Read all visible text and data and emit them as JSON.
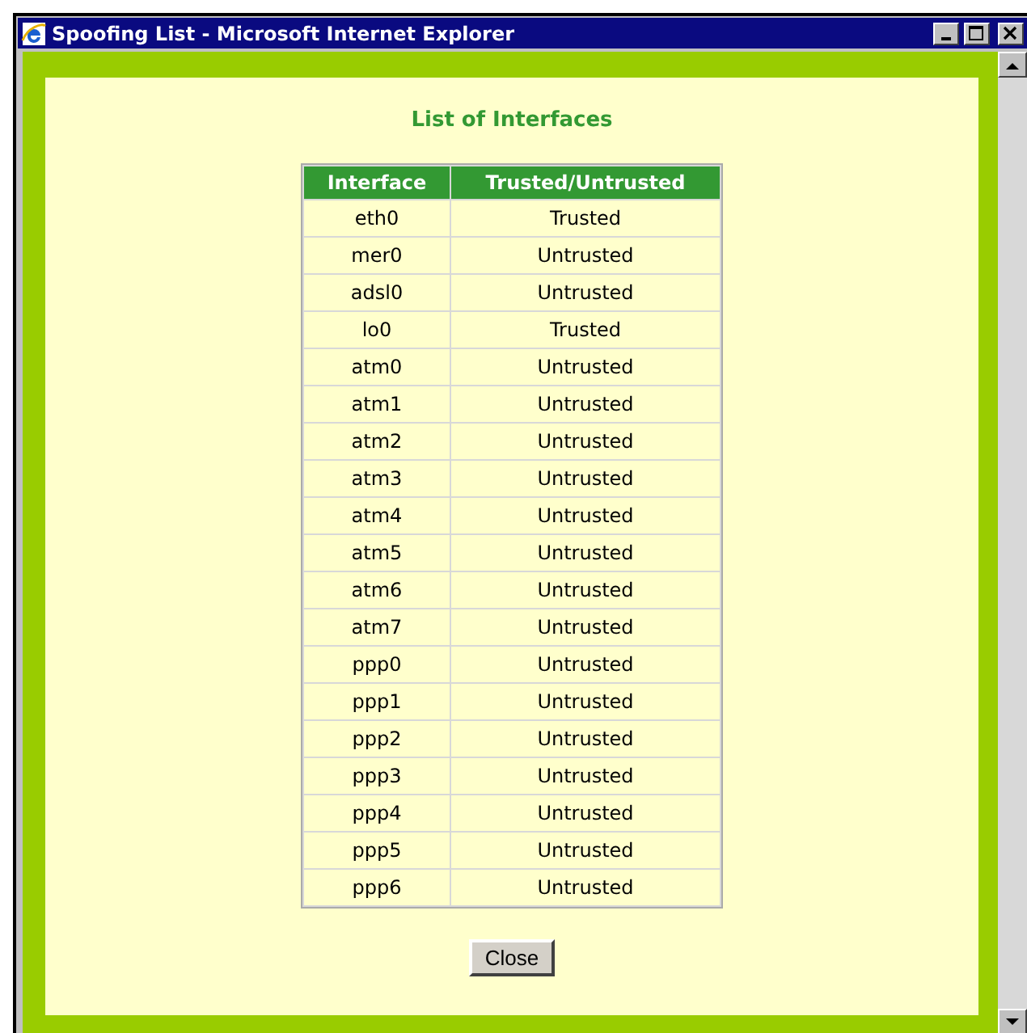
{
  "window": {
    "title": "Spoofing List - Microsoft Internet Explorer"
  },
  "heading": "List of Interfaces",
  "table": {
    "columns": [
      "Interface",
      "Trusted/Untrusted"
    ],
    "rows": [
      [
        "eth0",
        "Trusted"
      ],
      [
        "mer0",
        "Untrusted"
      ],
      [
        "adsl0",
        "Untrusted"
      ],
      [
        "lo0",
        "Trusted"
      ],
      [
        "atm0",
        "Untrusted"
      ],
      [
        "atm1",
        "Untrusted"
      ],
      [
        "atm2",
        "Untrusted"
      ],
      [
        "atm3",
        "Untrusted"
      ],
      [
        "atm4",
        "Untrusted"
      ],
      [
        "atm5",
        "Untrusted"
      ],
      [
        "atm6",
        "Untrusted"
      ],
      [
        "atm7",
        "Untrusted"
      ],
      [
        "ppp0",
        "Untrusted"
      ],
      [
        "ppp1",
        "Untrusted"
      ],
      [
        "ppp2",
        "Untrusted"
      ],
      [
        "ppp3",
        "Untrusted"
      ],
      [
        "ppp4",
        "Untrusted"
      ],
      [
        "ppp5",
        "Untrusted"
      ],
      [
        "ppp6",
        "Untrusted"
      ]
    ]
  },
  "buttons": [
    "Close"
  ]
}
